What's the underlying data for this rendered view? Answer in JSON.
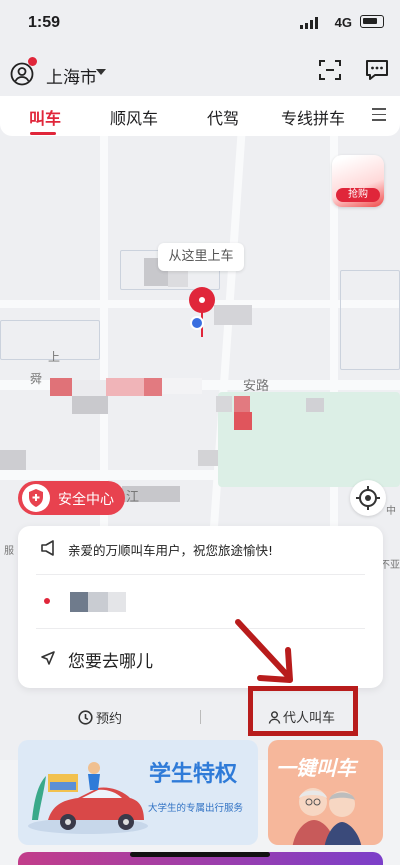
{
  "status": {
    "time": "1:59",
    "network": "4G"
  },
  "header": {
    "city": "上海市"
  },
  "tabs": [
    {
      "label": "叫车",
      "active": true
    },
    {
      "label": "顺风车"
    },
    {
      "label": "代驾"
    },
    {
      "label": "专线拼车"
    }
  ],
  "promo": {
    "label": "抢购"
  },
  "map": {
    "pickup_hint": "从这里上车",
    "labels": [
      "上",
      "舜",
      "安路",
      "江",
      "中",
      "不亚",
      "服"
    ]
  },
  "safety": {
    "label": "安全中心"
  },
  "card": {
    "notice": "亲爱的万顺叫车用户，祝您旅途愉快!",
    "destination_placeholder": "您要去哪儿"
  },
  "options": {
    "reserve": "预约",
    "proxy": "代人叫车"
  },
  "banners": {
    "student": {
      "title": "学生特权",
      "subtitle": "大学生的专属出行服务"
    },
    "onekey": {
      "title": "一键叫车"
    }
  },
  "colors": {
    "accent": "#e0263a",
    "annotation": "#b81c1c",
    "student_blue": "#2f7bd8"
  }
}
